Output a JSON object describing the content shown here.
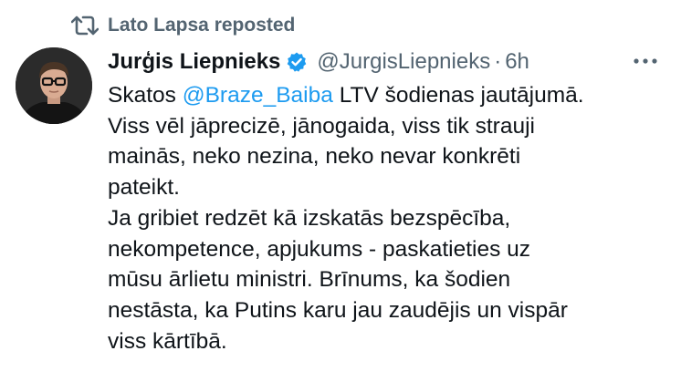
{
  "repost": {
    "label": "Lato Lapsa reposted",
    "icon": "repost-icon"
  },
  "author": {
    "display_name": "Jurģis Liepnieks",
    "handle": "@JurgisLiepnieks",
    "separator": "·",
    "time": "6h",
    "verified_icon": "verified-badge-icon",
    "verified_color": "#1d9bf0"
  },
  "more_icon": "more-options-icon",
  "tweet": {
    "line1_before": "Skatos ",
    "mention": "@Braze_Baiba",
    "line1_after": " LTV šodienas jautājumā.",
    "lines": [
      "Viss vēl jāprecizē, jānogaida, viss tik strauji",
      "mainās, neko nezina, neko nevar konkrēti",
      "pateikt.",
      "Ja gribiet redzēt kā izskatās bezspēcība,",
      "nekompetence, apjukums - paskatieties uz",
      "mūsu ārlietu ministri. Brīnums, ka šodien",
      "nestāsta, ka Putins karu jau zaudējis un vispār",
      "viss kārtībā."
    ]
  },
  "colors": {
    "text": "#0f1419",
    "muted": "#536471",
    "link": "#1d9bf0"
  }
}
